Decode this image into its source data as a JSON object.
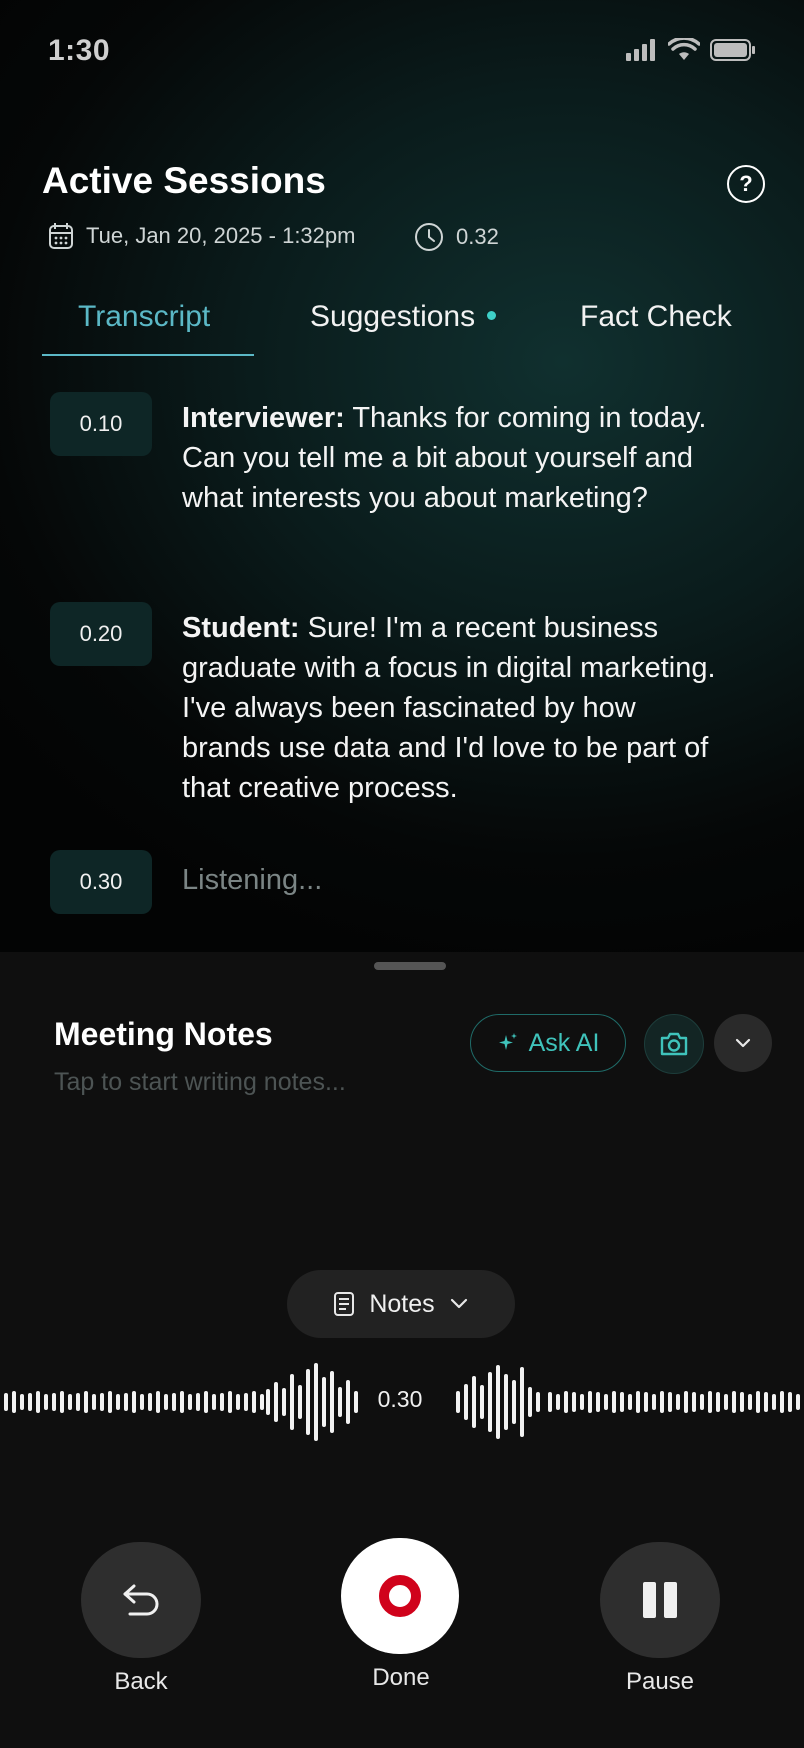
{
  "status_bar": {
    "time": "1:30"
  },
  "header": {
    "title": "Active Sessions",
    "date": "Tue, Jan 20, 2025  - 1:32pm",
    "duration": "0.32"
  },
  "tabs": [
    {
      "label": "Transcript",
      "active": true
    },
    {
      "label": "Suggestions",
      "active": false,
      "has_dot": true
    },
    {
      "label": "Fact Check",
      "active": false
    }
  ],
  "transcript": [
    {
      "stamp": "0.10",
      "speaker": "Interviewer:",
      "text": " Thanks for coming in today. Can you tell me a bit about yourself and what interests you about marketing?"
    },
    {
      "stamp": "0.20",
      "speaker": "Student:",
      "text": " Sure! I'm a recent business graduate with a focus in digital marketing. I've always been fascinated by how brands use data and I'd love to be part of that creative process."
    },
    {
      "stamp": "0.30",
      "listening": "Listening..."
    }
  ],
  "notes": {
    "title": "Meeting Notes",
    "placeholder": "Tap to start writing notes...",
    "ask_ai": "Ask AI"
  },
  "mode_selector": {
    "label": "Notes"
  },
  "recording": {
    "time": "0.30"
  },
  "controls": {
    "back": "Back",
    "done": "Done",
    "pause": "Pause"
  },
  "colors": {
    "accent": "#5bb8c6",
    "teal": "#3fc3bb",
    "record_red": "#d0021b"
  }
}
